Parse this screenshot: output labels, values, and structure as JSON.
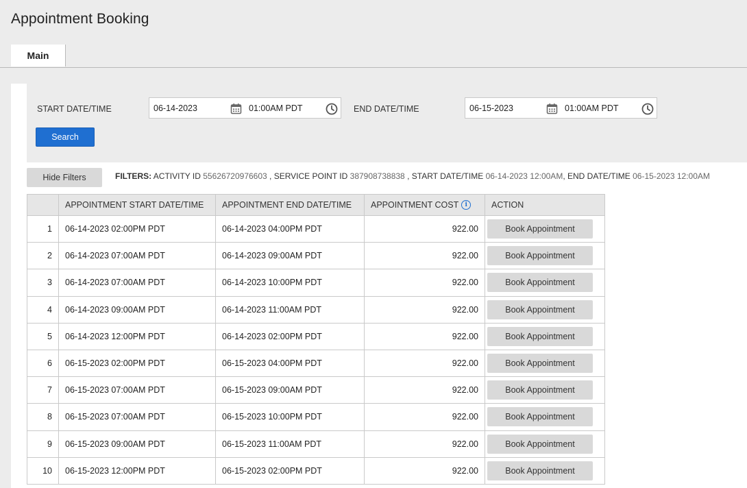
{
  "page": {
    "title": "Appointment Booking"
  },
  "tabs": [
    {
      "label": "Main"
    }
  ],
  "filters": {
    "start_label": "START DATE/TIME",
    "start_date": "06-14-2023",
    "start_time": "01:00AM PDT",
    "end_label": "END DATE/TIME",
    "end_date": "06-15-2023",
    "end_time": "01:00AM PDT",
    "search_label": "Search",
    "hide_label": "Hide Filters",
    "summary_title": "FILTERS:",
    "summary": [
      {
        "key": "ACTIVITY ID",
        "value": "55626720976603",
        "sep": " ,"
      },
      {
        "key": "SERVICE POINT ID",
        "value": "387908738838",
        "sep": " ,"
      },
      {
        "key": "START DATE/TIME",
        "value": "06-14-2023 12:00AM",
        "sep": ","
      },
      {
        "key": "END DATE/TIME",
        "value": "06-15-2023 12:00AM",
        "sep": ""
      }
    ]
  },
  "table": {
    "headers": [
      "",
      "APPOINTMENT START DATE/TIME",
      "APPOINTMENT END DATE/TIME",
      "APPOINTMENT COST",
      "ACTION"
    ],
    "action_label": "Book Appointment",
    "rows": [
      {
        "n": "1",
        "start": "06-14-2023 02:00PM PDT",
        "end": "06-14-2023 04:00PM PDT",
        "cost": "922.00"
      },
      {
        "n": "2",
        "start": "06-14-2023 07:00AM PDT",
        "end": "06-14-2023 09:00AM PDT",
        "cost": "922.00"
      },
      {
        "n": "3",
        "start": "06-14-2023 07:00AM PDT",
        "end": "06-14-2023 10:00PM PDT",
        "cost": "922.00"
      },
      {
        "n": "4",
        "start": "06-14-2023 09:00AM PDT",
        "end": "06-14-2023 11:00AM PDT",
        "cost": "922.00"
      },
      {
        "n": "5",
        "start": "06-14-2023 12:00PM PDT",
        "end": "06-14-2023 02:00PM PDT",
        "cost": "922.00"
      },
      {
        "n": "6",
        "start": "06-15-2023 02:00PM PDT",
        "end": "06-15-2023 04:00PM PDT",
        "cost": "922.00"
      },
      {
        "n": "7",
        "start": "06-15-2023 07:00AM PDT",
        "end": "06-15-2023 09:00AM PDT",
        "cost": "922.00"
      },
      {
        "n": "8",
        "start": "06-15-2023 07:00AM PDT",
        "end": "06-15-2023 10:00PM PDT",
        "cost": "922.00"
      },
      {
        "n": "9",
        "start": "06-15-2023 09:00AM PDT",
        "end": "06-15-2023 11:00AM PDT",
        "cost": "922.00"
      },
      {
        "n": "10",
        "start": "06-15-2023 12:00PM PDT",
        "end": "06-15-2023 02:00PM PDT",
        "cost": "922.00"
      }
    ]
  },
  "icons": {
    "calendar": "calendar-icon",
    "clock": "clock-icon",
    "info": "info-icon"
  },
  "colors": {
    "primary": "#1f6fd1",
    "info": "#1f6fd1"
  }
}
